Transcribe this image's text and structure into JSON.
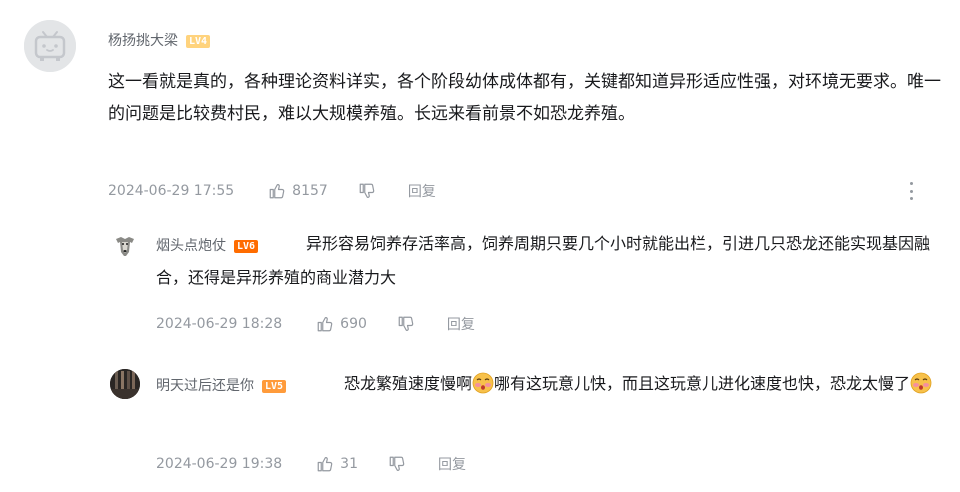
{
  "comments": [
    {
      "username": "杨扬挑大梁",
      "level": "LV4",
      "text": "这一看就是真的，各种理论资料详实，各个阶段幼体成体都有，关键都知道异形适应性强，对环境无要求。唯一的问题是比较费村民，难以大规模养殖。长远来看前景不如恐龙养殖。",
      "time": "2024-06-29 17:55",
      "likes": "8157",
      "reply_label": "回复"
    }
  ],
  "replies": [
    {
      "username": "烟头点炮仗",
      "level": "LV6",
      "text": "异形容易饲养存活率高，饲养周期只要几个小时就能出栏，引进几只恐龙还能实现基因融合，还得是异形养殖的商业潜力大",
      "time": "2024-06-29 18:28",
      "likes": "690",
      "reply_label": "回复"
    },
    {
      "username": "明天过后还是你",
      "level": "LV5",
      "text_part1": "恐龙繁殖速度慢啊",
      "text_part2": "哪有这玩意儿快，而且这玩意儿进化速度也快，恐龙太慢了",
      "time": "2024-06-29 19:38",
      "likes": "31",
      "reply_label": "回复"
    }
  ],
  "icons": {
    "like": "thumbs-up-icon",
    "dislike": "thumbs-down-icon",
    "more": "more-vertical-icon",
    "emoji": "blush-emoji-icon"
  },
  "colors": {
    "text_primary": "#18191c",
    "text_secondary": "#61666d",
    "meta": "#9499a0",
    "lv4": "#ffd37d",
    "lv5": "#ff9b3b",
    "lv6": "#ff6c00"
  }
}
